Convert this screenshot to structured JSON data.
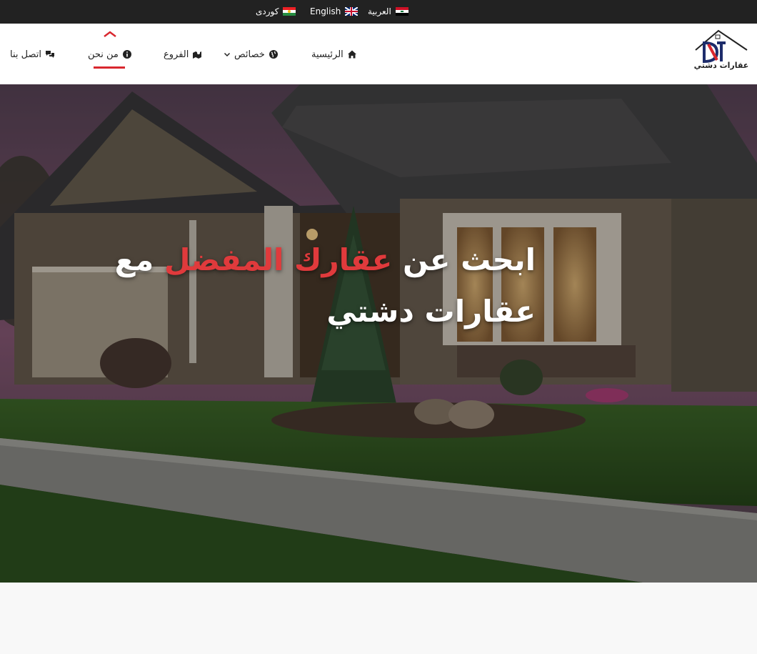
{
  "languages": [
    {
      "label": "العربية",
      "flag": "flag-iraq-icon"
    },
    {
      "label": "English",
      "flag": "flag-uk-icon"
    },
    {
      "label": "كوردى",
      "flag": "flag-kurdistan-icon"
    }
  ],
  "brand": {
    "logo_text": "عقارات دشتي"
  },
  "nav": {
    "home": "الرئيسية",
    "features": "خصائص",
    "branches": "الفروع",
    "about": "من نحن",
    "contact": "اتصل بنا",
    "active": "about"
  },
  "hero": {
    "title_part1": "ابحث عن ",
    "title_highlight": "عقارك المفضل",
    "title_part2": " مع عقارات دشتي"
  },
  "colors": {
    "topbar": "#222222",
    "accent": "#d9272e",
    "text": "#222222"
  }
}
